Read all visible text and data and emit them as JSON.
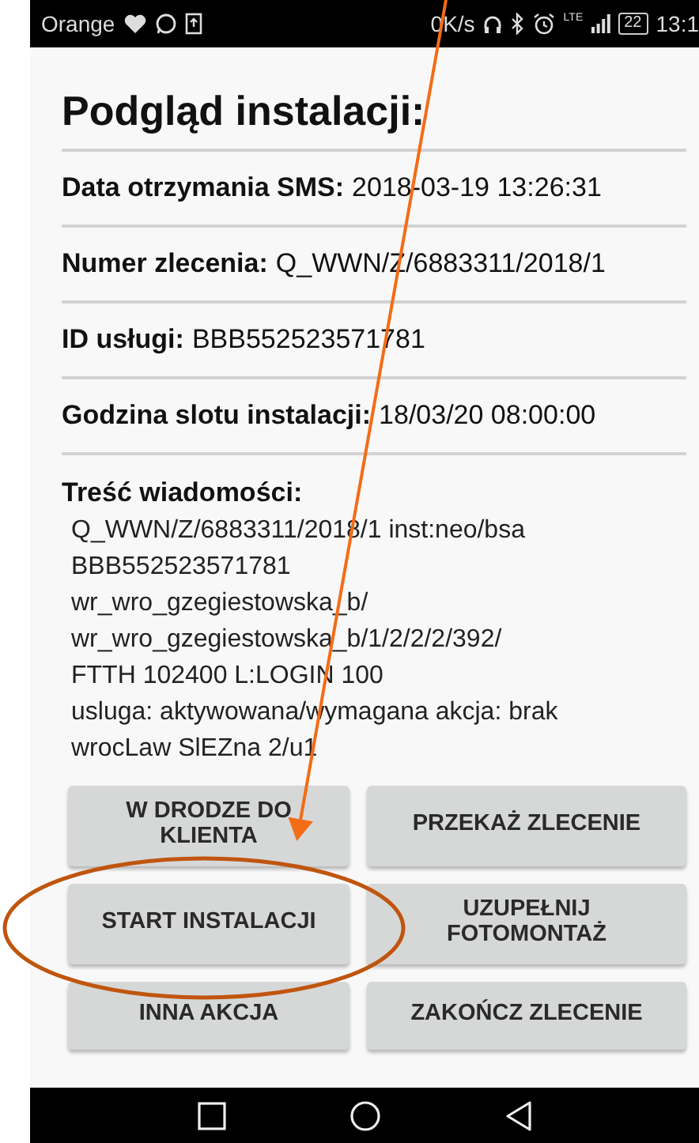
{
  "status_bar": {
    "carrier": "Orange",
    "network_speed": "0K/s",
    "network_type": "LTE",
    "battery": "22",
    "time": "13:1"
  },
  "title": "Podgląd instalacji:",
  "fields": [
    {
      "label": "Data otrzymania SMS:",
      "value": "2018-03-19 13:26:31"
    },
    {
      "label": "Numer zlecenia:",
      "value": "Q_WWN/Z/6883311/2018/1"
    },
    {
      "label": "ID usługi:",
      "value": "BBB552523571781"
    },
    {
      "label": "Godzina slotu instalacji:",
      "value": "18/03/20 08:00:00"
    }
  ],
  "message": {
    "label": "Treść wiadomości:",
    "lines": [
      "Q_WWN/Z/6883311/2018/1 inst:neo/bsa",
      "BBB552523571781",
      "wr_wro_gzegiestowska_b/",
      "wr_wro_gzegiestowska_b/1/2/2/2/392/",
      "FTTH 102400 L:LOGIN 100",
      "usluga: aktywowana/wymagana akcja: brak",
      "wrocLaw SlEZna 2/u1"
    ]
  },
  "buttons": [
    {
      "label": "W DRODZE DO\nKLIENTA"
    },
    {
      "label": "PRZEKAŻ ZLECENIE"
    },
    {
      "label": "START INSTALACJI"
    },
    {
      "label": "UZUPEŁNIJ\nFOTOMONTAŻ"
    },
    {
      "label": "INNA AKCJA"
    },
    {
      "label": "ZAKOŃCZ ZLECENIE"
    }
  ]
}
